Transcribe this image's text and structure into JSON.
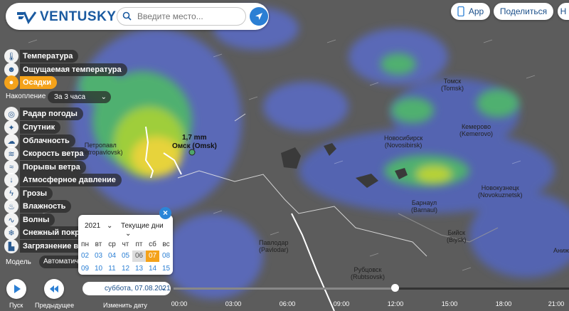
{
  "app": {
    "brand": "VENTUSKY"
  },
  "search": {
    "placeholder": "Введите место..."
  },
  "topbar": {
    "app_label": "App",
    "share_label": "Поделиться",
    "third_label": "Н"
  },
  "layers": [
    {
      "label": "Температура",
      "icon": "thermometer-icon"
    },
    {
      "label": "Ощущаемая температура",
      "icon": "person-temperature-icon"
    },
    {
      "label": "Осадки",
      "icon": "drop-icon",
      "active": true
    },
    {
      "label": "Радар погоды",
      "icon": "radar-icon"
    },
    {
      "label": "Спутник",
      "icon": "satellite-icon"
    },
    {
      "label": "Облачность",
      "icon": "cloud-icon"
    },
    {
      "label": "Скорость ветра",
      "icon": "wind-icon"
    },
    {
      "label": "Порывы ветра",
      "icon": "gust-icon"
    },
    {
      "label": "Атмосферное давление",
      "icon": "pressure-icon"
    },
    {
      "label": "Грозы",
      "icon": "lightning-icon"
    },
    {
      "label": "Влажность",
      "icon": "humidity-icon"
    },
    {
      "label": "Волны",
      "icon": "waves-icon"
    },
    {
      "label": "Снежный покров",
      "icon": "snowflake-icon"
    },
    {
      "label": "Загрязнение воз",
      "icon": "factory-icon"
    }
  ],
  "accumulation": {
    "label": "Накопление",
    "value": "За 3 часа"
  },
  "model": {
    "label": "Модель",
    "value": "Автоматич"
  },
  "calendar": {
    "year": "2021",
    "range": "Текущие дни",
    "weekdays": [
      "пн",
      "вт",
      "ср",
      "чт",
      "пт",
      "сб",
      "вс"
    ],
    "days": [
      "02",
      "03",
      "04",
      "05",
      "06",
      "07",
      "08",
      "09",
      "10",
      "11",
      "12",
      "13",
      "14",
      "15"
    ],
    "selected_day": "07",
    "past_day": "06"
  },
  "bottom": {
    "play_label": "Пуск",
    "prev_label": "Предыдущее",
    "date_value": "суббота, 07.08.2021",
    "change_date_label": "Изменить дату",
    "times": [
      "00:00",
      "03:00",
      "06:00",
      "09:00",
      "12:00",
      "15:00",
      "18:00",
      "21:00"
    ],
    "progress": 0.56
  },
  "map": {
    "marker_value": "1,7 mm",
    "marker_city": "Омск (Omsk)",
    "cities": [
      {
        "name": "Томск",
        "latin": "(Tomsk)"
      },
      {
        "name": "Кемерово",
        "latin": "(Kemerovo)"
      },
      {
        "name": "Новосибирск",
        "latin": "(Novosibirsk)"
      },
      {
        "name": "Петропавл",
        "latin": "(Petropavlovsk)"
      },
      {
        "name": "Барнаул",
        "latin": "(Barnaul)"
      },
      {
        "name": "Новокузнецк",
        "latin": "(Novokuznetsk)"
      },
      {
        "name": "Бийск",
        "latin": "(Biysk)"
      },
      {
        "name": "Павлодар",
        "latin": "(Pavlodar)"
      },
      {
        "name": "Рубцовск",
        "latin": "(Rubtsovsk)"
      },
      {
        "name": "Аниж",
        "latin": ""
      }
    ]
  },
  "colors": {
    "accent": "#f4a21a",
    "brand": "#1a5aa0",
    "button": "#2b7fd4"
  }
}
